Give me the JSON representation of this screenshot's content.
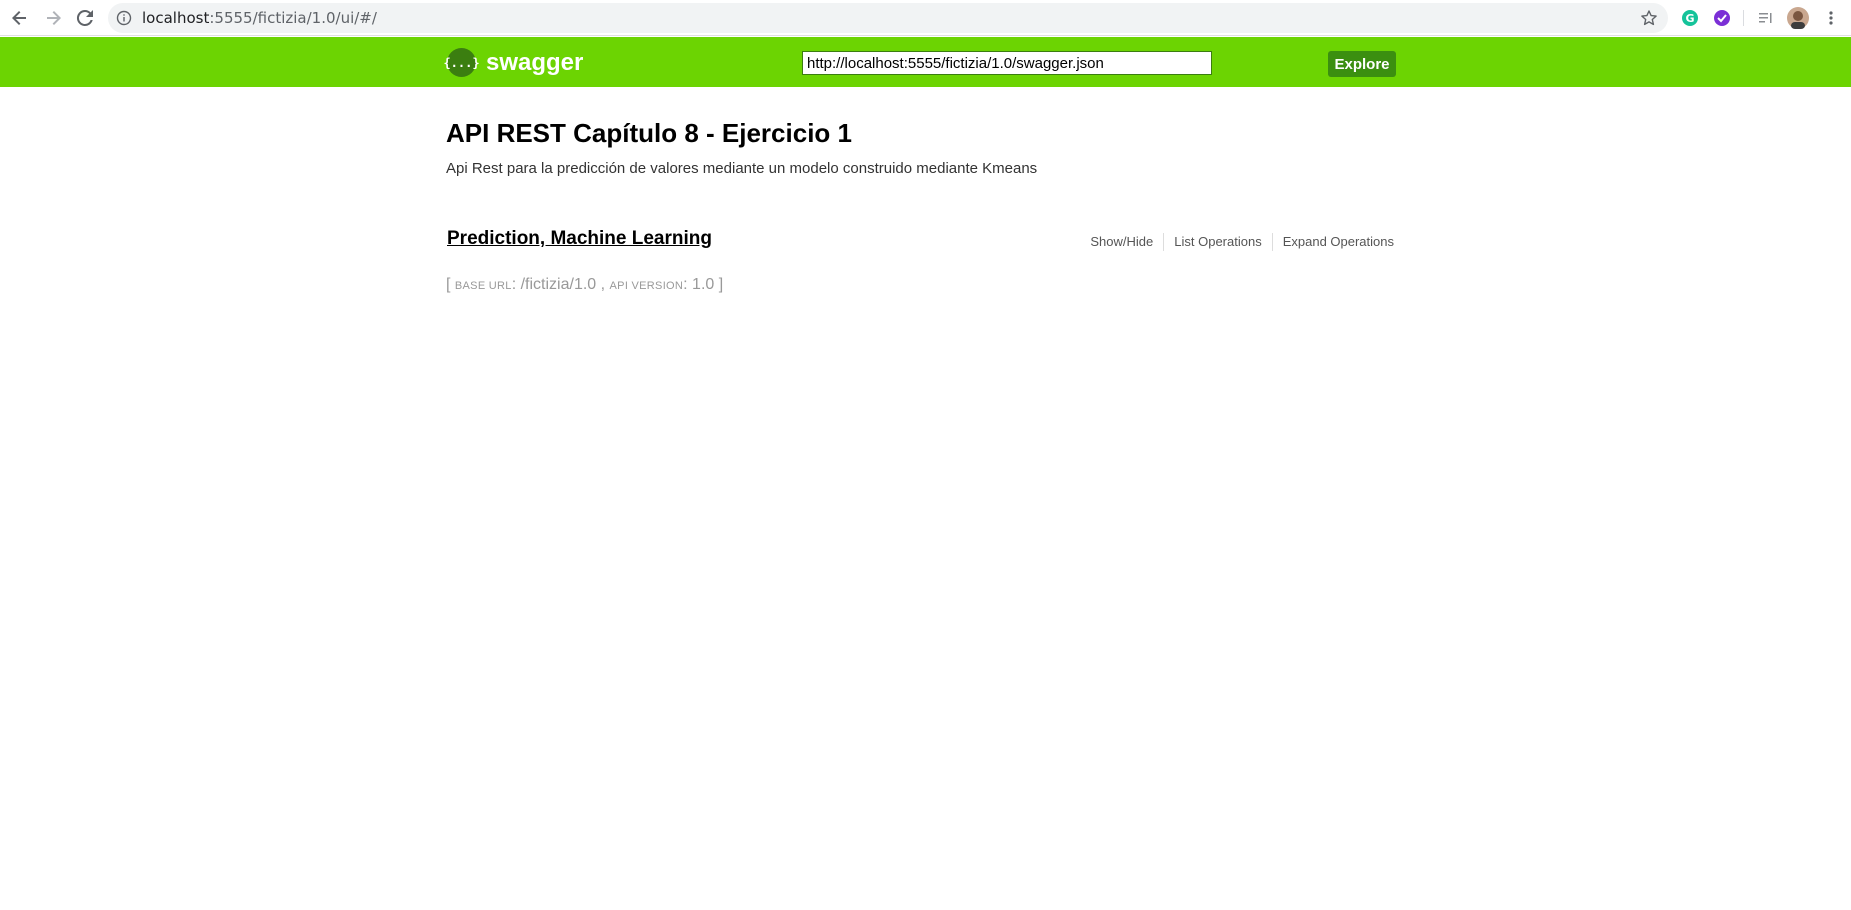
{
  "browser": {
    "url_host": "localhost",
    "url_path": ":5555/fictizia/1.0/ui/#/",
    "icons": [
      "back-icon",
      "forward-icon",
      "reload-icon",
      "info-icon",
      "star-icon",
      "grammarly-icon",
      "extension-check-icon",
      "reading-list-icon",
      "avatar",
      "menu-icon"
    ]
  },
  "header": {
    "logo_symbol": "{...}",
    "logo_text": "swagger",
    "spec_url": "http://localhost:5555/fictizia/1.0/swagger.json",
    "explore_label": "Explore",
    "colors": {
      "bar": "#6cd402",
      "button": "#3b8f10"
    }
  },
  "api": {
    "title": "API REST Capítulo 8 - Ejercicio 1",
    "description": "Api Rest para la predicción de valores mediante un modelo construido mediante Kmeans"
  },
  "resource": {
    "name": "Prediction, Machine Learning",
    "show_hide": "Show/Hide",
    "list_operations": "List Operations",
    "expand_operations": "Expand Operations"
  },
  "footer": {
    "open_bracket": "[",
    "base_url_label": "base url",
    "base_url": "/fictizia/1.0",
    "api_version_label": "api version",
    "api_version": "1.0",
    "close_bracket": "]"
  }
}
